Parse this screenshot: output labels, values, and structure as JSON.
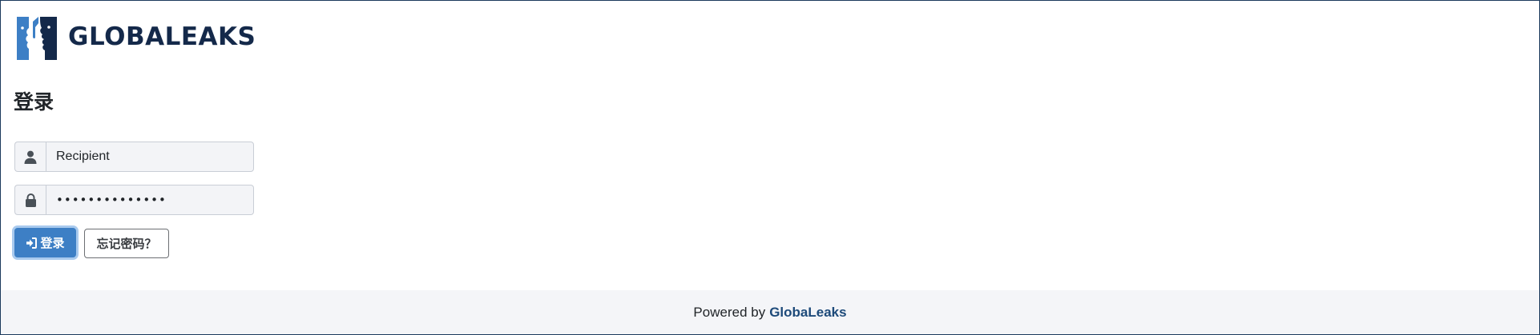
{
  "header": {
    "logo_text": "GLOBALEAKS",
    "logo_icon": "globaleaks-faces-logo"
  },
  "login": {
    "title": "登录",
    "username": {
      "value": "Recipient",
      "icon": "user-icon"
    },
    "password": {
      "value": "••••••••••••••",
      "icon": "lock-icon"
    },
    "login_button": {
      "label": "登录",
      "icon": "sign-in-icon"
    },
    "forgot_button": {
      "label": "忘记密码？"
    }
  },
  "footer": {
    "powered_by": "Powered by",
    "brand": "GlobaLeaks"
  },
  "colors": {
    "brand_dark": "#14294a",
    "brand_light": "#3d7fc5",
    "primary_button": "#3d7fc5",
    "footer_bg": "#f4f5f8",
    "footer_link": "#1d4a7a"
  }
}
